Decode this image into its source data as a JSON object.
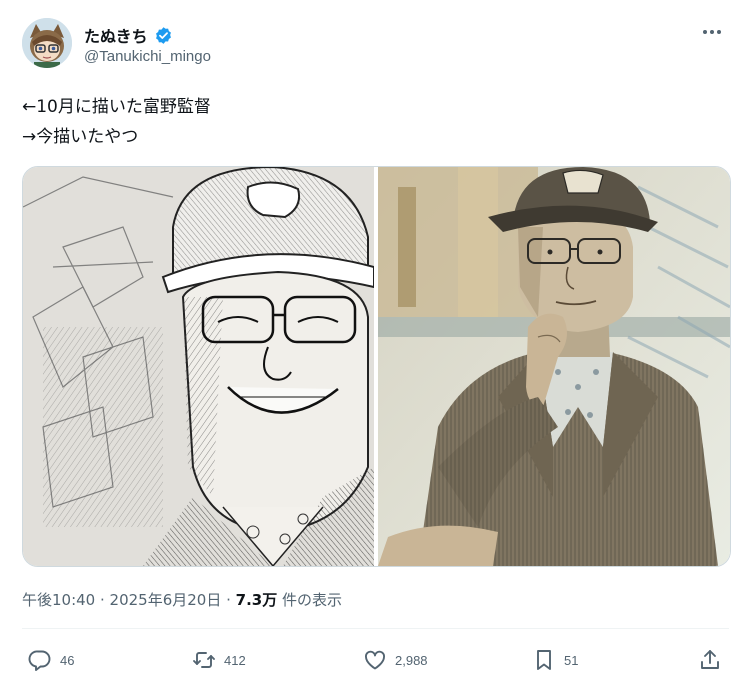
{
  "author": {
    "display_name": "たぬきち",
    "handle": "@Tanukichi_mingo",
    "verified": true
  },
  "tweet": {
    "lines": [
      "←10月に描いた富野監督",
      "→今描いたやつ"
    ]
  },
  "meta": {
    "time": "午後10:40",
    "separator": " · ",
    "date": "2025年6月20日",
    "views_count": "7.3万",
    "views_label": "件の表示"
  },
  "actions": {
    "replies": "46",
    "reposts": "412",
    "likes": "2,988",
    "bookmarks": "51"
  },
  "colors": {
    "text_primary": "#0f1419",
    "text_secondary": "#536471",
    "verified_blue": "#1d9bf0",
    "border": "#cfd9de"
  },
  "icons": {
    "more": "more-dots-icon",
    "verified": "verified-badge-icon",
    "reply": "reply-icon",
    "repost": "repost-icon",
    "like": "heart-icon",
    "bookmark": "bookmark-icon",
    "share": "share-icon"
  }
}
